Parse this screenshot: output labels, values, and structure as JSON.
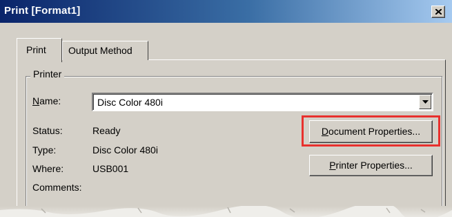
{
  "window": {
    "title": "Print [Format1]",
    "close_glyph": "×"
  },
  "tabs": [
    {
      "label": "Print",
      "selected": true
    },
    {
      "label": "Output Method",
      "selected": false
    }
  ],
  "printer_group": {
    "legend": "Printer",
    "name_label_prefix": "N",
    "name_label_rest": "ame:",
    "name_value": "Disc Color 480i",
    "status_label": "Status:",
    "status_value": "Ready",
    "type_label": "Type:",
    "type_value": "Disc Color 480i",
    "where_label": "Where:",
    "where_value": "USB001",
    "comments_label": "Comments:",
    "comments_value": ""
  },
  "buttons": {
    "document_properties_prefix": "D",
    "document_properties_rest": "ocument Properties...",
    "printer_properties_prefix": "P",
    "printer_properties_rest": "rinter Properties..."
  },
  "colors": {
    "highlight": "#e8302d",
    "title_bar_start": "#0a246a",
    "title_bar_end": "#a6caf0",
    "face": "#d4d0c8"
  },
  "icons": {
    "close": "close-icon",
    "dropdown": "chevron-down-icon"
  }
}
